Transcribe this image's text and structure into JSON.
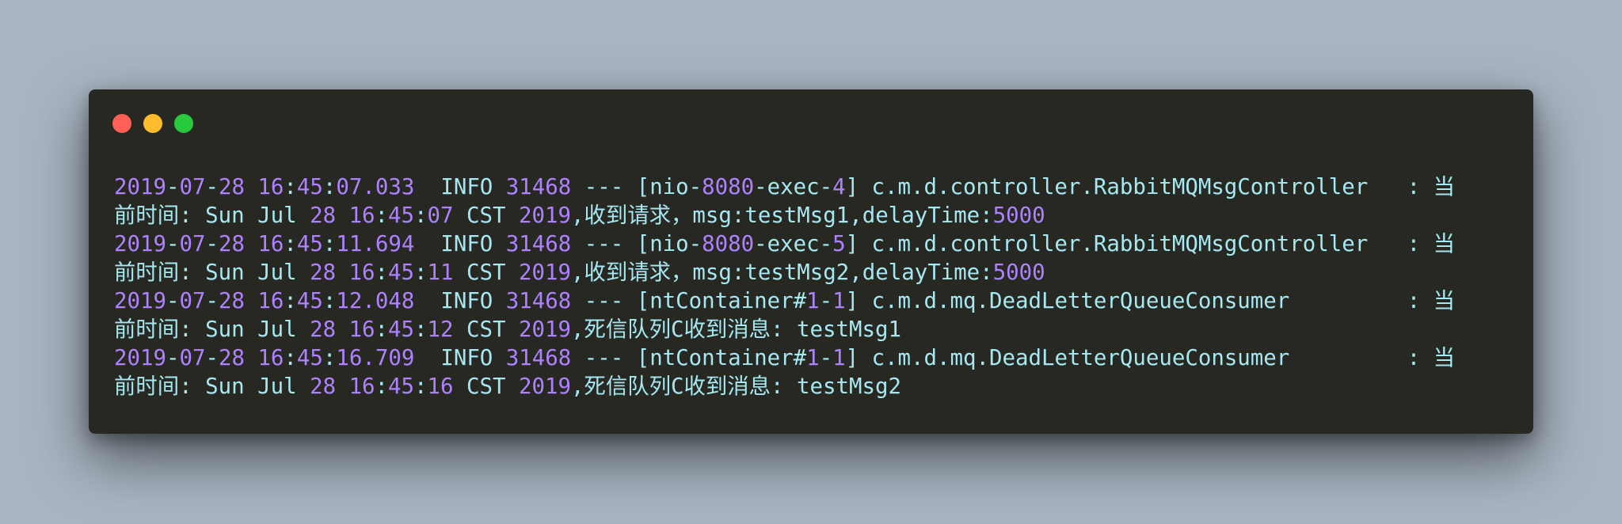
{
  "window": {
    "controls": [
      {
        "name": "close",
        "color": "#ff5f56"
      },
      {
        "name": "minimize",
        "color": "#ffbd2e"
      },
      {
        "name": "maximize",
        "color": "#27c93f"
      }
    ]
  },
  "colors": {
    "background": "#a8b4c1",
    "window": "#272822",
    "text": "#a6e8f2",
    "number": "#ae81ff"
  },
  "log_lines": [
    [
      {
        "t": "num",
        "v": "2019"
      },
      {
        "t": "txt",
        "v": "-"
      },
      {
        "t": "num",
        "v": "07"
      },
      {
        "t": "txt",
        "v": "-"
      },
      {
        "t": "num",
        "v": "28"
      },
      {
        "t": "txt",
        "v": " "
      },
      {
        "t": "num",
        "v": "16"
      },
      {
        "t": "txt",
        "v": ":"
      },
      {
        "t": "num",
        "v": "45"
      },
      {
        "t": "txt",
        "v": ":"
      },
      {
        "t": "num",
        "v": "07.033"
      },
      {
        "t": "txt",
        "v": "  INFO "
      },
      {
        "t": "num",
        "v": "31468"
      },
      {
        "t": "txt",
        "v": " --- [nio-"
      },
      {
        "t": "num",
        "v": "8080"
      },
      {
        "t": "txt",
        "v": "-exec-"
      },
      {
        "t": "num",
        "v": "4"
      },
      {
        "t": "txt",
        "v": "] c.m.d.controller.RabbitMQMsgController   : 当"
      }
    ],
    [
      {
        "t": "txt",
        "v": "前时间: Sun Jul "
      },
      {
        "t": "num",
        "v": "28"
      },
      {
        "t": "txt",
        "v": " "
      },
      {
        "t": "num",
        "v": "16"
      },
      {
        "t": "txt",
        "v": ":"
      },
      {
        "t": "num",
        "v": "45"
      },
      {
        "t": "txt",
        "v": ":"
      },
      {
        "t": "num",
        "v": "07"
      },
      {
        "t": "txt",
        "v": " CST "
      },
      {
        "t": "num",
        "v": "2019"
      },
      {
        "t": "txt",
        "v": ",收到请求，msg:testMsg1,delayTime:"
      },
      {
        "t": "num",
        "v": "5000"
      }
    ],
    [
      {
        "t": "num",
        "v": "2019"
      },
      {
        "t": "txt",
        "v": "-"
      },
      {
        "t": "num",
        "v": "07"
      },
      {
        "t": "txt",
        "v": "-"
      },
      {
        "t": "num",
        "v": "28"
      },
      {
        "t": "txt",
        "v": " "
      },
      {
        "t": "num",
        "v": "16"
      },
      {
        "t": "txt",
        "v": ":"
      },
      {
        "t": "num",
        "v": "45"
      },
      {
        "t": "txt",
        "v": ":"
      },
      {
        "t": "num",
        "v": "11.694"
      },
      {
        "t": "txt",
        "v": "  INFO "
      },
      {
        "t": "num",
        "v": "31468"
      },
      {
        "t": "txt",
        "v": " --- [nio-"
      },
      {
        "t": "num",
        "v": "8080"
      },
      {
        "t": "txt",
        "v": "-exec-"
      },
      {
        "t": "num",
        "v": "5"
      },
      {
        "t": "txt",
        "v": "] c.m.d.controller.RabbitMQMsgController   : 当"
      }
    ],
    [
      {
        "t": "txt",
        "v": "前时间: Sun Jul "
      },
      {
        "t": "num",
        "v": "28"
      },
      {
        "t": "txt",
        "v": " "
      },
      {
        "t": "num",
        "v": "16"
      },
      {
        "t": "txt",
        "v": ":"
      },
      {
        "t": "num",
        "v": "45"
      },
      {
        "t": "txt",
        "v": ":"
      },
      {
        "t": "num",
        "v": "11"
      },
      {
        "t": "txt",
        "v": " CST "
      },
      {
        "t": "num",
        "v": "2019"
      },
      {
        "t": "txt",
        "v": ",收到请求，msg:testMsg2,delayTime:"
      },
      {
        "t": "num",
        "v": "5000"
      }
    ],
    [
      {
        "t": "num",
        "v": "2019"
      },
      {
        "t": "txt",
        "v": "-"
      },
      {
        "t": "num",
        "v": "07"
      },
      {
        "t": "txt",
        "v": "-"
      },
      {
        "t": "num",
        "v": "28"
      },
      {
        "t": "txt",
        "v": " "
      },
      {
        "t": "num",
        "v": "16"
      },
      {
        "t": "txt",
        "v": ":"
      },
      {
        "t": "num",
        "v": "45"
      },
      {
        "t": "txt",
        "v": ":"
      },
      {
        "t": "num",
        "v": "12.048"
      },
      {
        "t": "txt",
        "v": "  INFO "
      },
      {
        "t": "num",
        "v": "31468"
      },
      {
        "t": "txt",
        "v": " --- [ntContainer#"
      },
      {
        "t": "num",
        "v": "1"
      },
      {
        "t": "txt",
        "v": "-"
      },
      {
        "t": "num",
        "v": "1"
      },
      {
        "t": "txt",
        "v": "] c.m.d.mq.DeadLetterQueueConsumer         : 当"
      }
    ],
    [
      {
        "t": "txt",
        "v": "前时间: Sun Jul "
      },
      {
        "t": "num",
        "v": "28"
      },
      {
        "t": "txt",
        "v": " "
      },
      {
        "t": "num",
        "v": "16"
      },
      {
        "t": "txt",
        "v": ":"
      },
      {
        "t": "num",
        "v": "45"
      },
      {
        "t": "txt",
        "v": ":"
      },
      {
        "t": "num",
        "v": "12"
      },
      {
        "t": "txt",
        "v": " CST "
      },
      {
        "t": "num",
        "v": "2019"
      },
      {
        "t": "txt",
        "v": ",死信队列C收到消息: testMsg1"
      }
    ],
    [
      {
        "t": "num",
        "v": "2019"
      },
      {
        "t": "txt",
        "v": "-"
      },
      {
        "t": "num",
        "v": "07"
      },
      {
        "t": "txt",
        "v": "-"
      },
      {
        "t": "num",
        "v": "28"
      },
      {
        "t": "txt",
        "v": " "
      },
      {
        "t": "num",
        "v": "16"
      },
      {
        "t": "txt",
        "v": ":"
      },
      {
        "t": "num",
        "v": "45"
      },
      {
        "t": "txt",
        "v": ":"
      },
      {
        "t": "num",
        "v": "16.709"
      },
      {
        "t": "txt",
        "v": "  INFO "
      },
      {
        "t": "num",
        "v": "31468"
      },
      {
        "t": "txt",
        "v": " --- [ntContainer#"
      },
      {
        "t": "num",
        "v": "1"
      },
      {
        "t": "txt",
        "v": "-"
      },
      {
        "t": "num",
        "v": "1"
      },
      {
        "t": "txt",
        "v": "] c.m.d.mq.DeadLetterQueueConsumer         : 当"
      }
    ],
    [
      {
        "t": "txt",
        "v": "前时间: Sun Jul "
      },
      {
        "t": "num",
        "v": "28"
      },
      {
        "t": "txt",
        "v": " "
      },
      {
        "t": "num",
        "v": "16"
      },
      {
        "t": "txt",
        "v": ":"
      },
      {
        "t": "num",
        "v": "45"
      },
      {
        "t": "txt",
        "v": ":"
      },
      {
        "t": "num",
        "v": "16"
      },
      {
        "t": "txt",
        "v": " CST "
      },
      {
        "t": "num",
        "v": "2019"
      },
      {
        "t": "txt",
        "v": ",死信队列C收到消息: testMsg2"
      }
    ]
  ]
}
